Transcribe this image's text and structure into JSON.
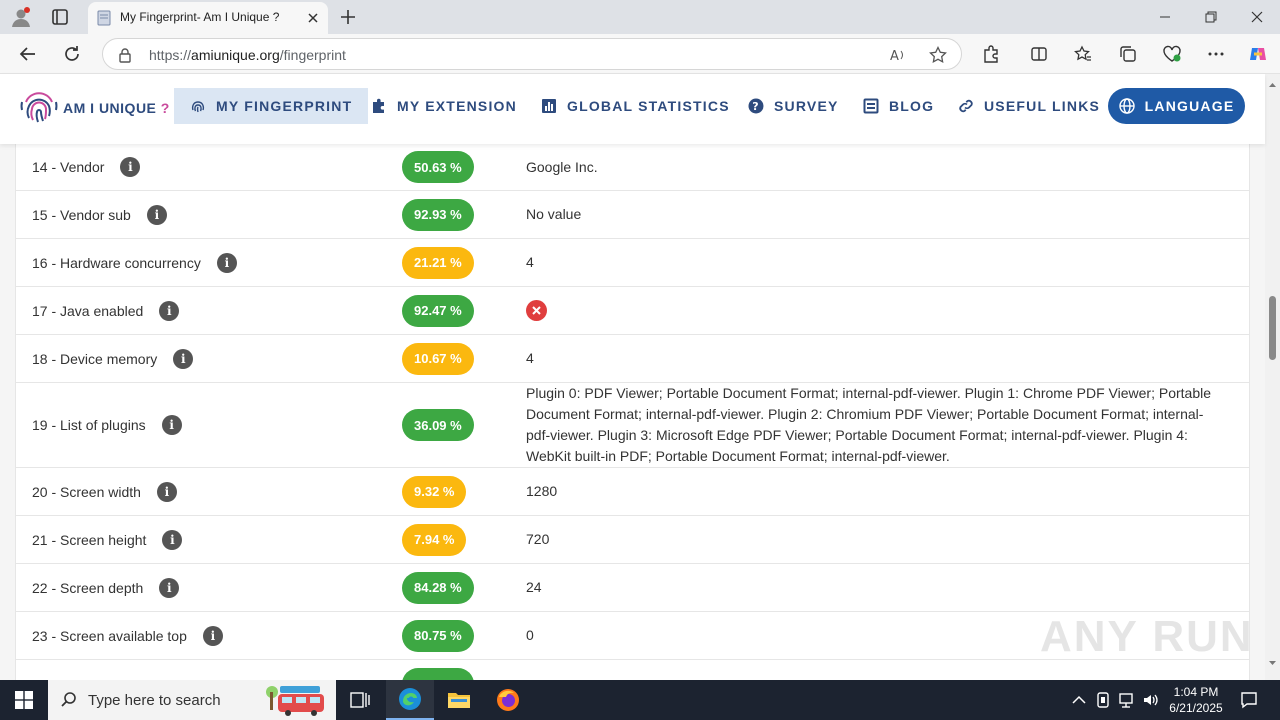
{
  "browser": {
    "tab_title": "My Fingerprint- Am I Unique ?",
    "url_prefix": "https://",
    "url_domain": "amiunique.org",
    "url_path": "/fingerprint"
  },
  "site": {
    "logo_text": "AM I UNIQUE",
    "logo_mark": "?",
    "nav": [
      {
        "label": "MY FINGERPRINT",
        "icon": "fingerprint-icon"
      },
      {
        "label": "MY EXTENSION",
        "icon": "puzzle-icon"
      },
      {
        "label": "GLOBAL STATISTICS",
        "icon": "chart-icon"
      },
      {
        "label": "SURVEY",
        "icon": "question-icon"
      },
      {
        "label": "BLOG",
        "icon": "blog-icon"
      },
      {
        "label": "USEFUL LINKS",
        "icon": "link-icon"
      }
    ],
    "language_label": "LANGUAGE",
    "colors": {
      "brand": "#2e4b7e",
      "language_bg": "#1f5aa6",
      "green": "#3da843",
      "yellow": "#fbb80f"
    }
  },
  "rows": [
    {
      "attr": "14 - Vendor",
      "pct": "50.63 %",
      "level": "green",
      "value": "Google Inc."
    },
    {
      "attr": "15 - Vendor sub",
      "pct": "92.93 %",
      "level": "green",
      "value": "No value"
    },
    {
      "attr": "16 - Hardware concurrency",
      "pct": "21.21 %",
      "level": "yellow",
      "value": "4"
    },
    {
      "attr": "17 - Java enabled",
      "pct": "92.47 %",
      "level": "green",
      "value": "",
      "icon": "false-icon"
    },
    {
      "attr": "18 - Device memory",
      "pct": "10.67 %",
      "level": "yellow",
      "value": "4"
    },
    {
      "attr": "19 - List of plugins",
      "pct": "36.09 %",
      "level": "green",
      "value": "Plugin 0: PDF Viewer; Portable Document Format; internal-pdf-viewer. Plugin 1: Chrome PDF Viewer; Portable Document Format; internal-pdf-viewer. Plugin 2: Chromium PDF Viewer; Portable Document Format; internal-pdf-viewer. Plugin 3: Microsoft Edge PDF Viewer; Portable Document Format; internal-pdf-viewer. Plugin 4: WebKit built-in PDF; Portable Document Format; internal-pdf-viewer."
    },
    {
      "attr": "20 - Screen width",
      "pct": "9.32 %",
      "level": "yellow",
      "value": "1280"
    },
    {
      "attr": "21 - Screen height",
      "pct": "7.94 %",
      "level": "yellow",
      "value": "720"
    },
    {
      "attr": "22 - Screen depth",
      "pct": "84.28 %",
      "level": "green",
      "value": "24"
    },
    {
      "attr": "23 - Screen available top",
      "pct": "80.75 %",
      "level": "green",
      "value": "0"
    }
  ],
  "taskbar": {
    "search_placeholder": "Type here to search",
    "time": "1:04 PM",
    "date": "6/21/2025"
  },
  "watermark": "ANY RUN"
}
